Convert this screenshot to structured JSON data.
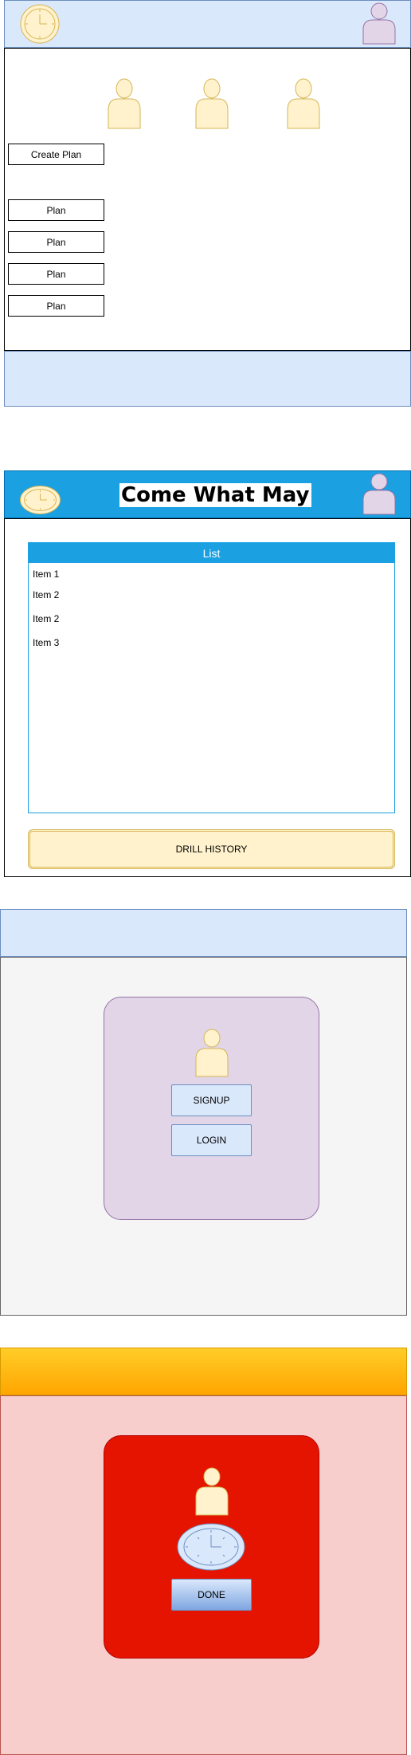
{
  "screen1": {
    "create_plan_label": "Create Plan",
    "plan_items": [
      "Plan",
      "Plan",
      "Plan",
      "Plan"
    ]
  },
  "screen2": {
    "title": "Come What May",
    "list": {
      "header": "List",
      "items": [
        "Item 1",
        "Item 2",
        "Item 2",
        "Item 3"
      ]
    },
    "drill_history_label": "DRILL HISTORY"
  },
  "screen3": {
    "signup_label": "SIGNUP",
    "login_label": "LOGIN"
  },
  "screen4": {
    "done_label": "DONE"
  },
  "icons": {
    "clock": "clock-icon",
    "user": "user-icon"
  },
  "colors": {
    "light_blue": "#dae8fc",
    "blue_header": "#1ba1e2",
    "purple_card": "#e1d5e7",
    "red_card": "#e51400",
    "pink_bg": "#f8cecc",
    "orange_header": "#ffa500",
    "yellow_fill": "#fff2cc"
  }
}
